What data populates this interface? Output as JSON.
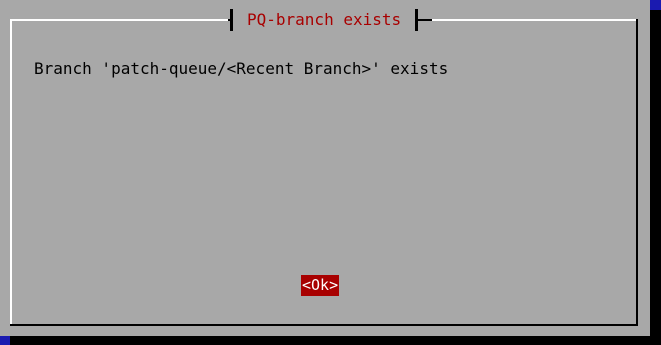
{
  "dialog": {
    "title": "PQ-branch exists",
    "message": "Branch 'patch-queue/<Recent Branch>' exists",
    "ok_label": "<Ok>"
  },
  "colors": {
    "background": "#1a1ab0",
    "dialog": "#a8a8a8",
    "title_text": "#a80000",
    "button_bg": "#a80000",
    "button_text": "#ffffff"
  }
}
